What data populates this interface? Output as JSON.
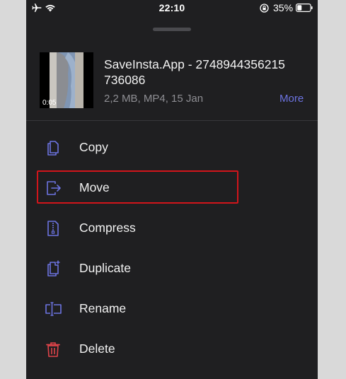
{
  "status_bar": {
    "time": "22:10",
    "battery_percent": "35%",
    "battery_level": 0.35
  },
  "file": {
    "name": "SaveInsta.App - 2748944356215736086",
    "meta": "2,2 MB, MP4, 15 Jan",
    "duration": "0:05",
    "more_label": "More"
  },
  "menu": {
    "items": [
      {
        "label": "Copy",
        "icon": "copy-icon"
      },
      {
        "label": "Move",
        "icon": "move-icon"
      },
      {
        "label": "Compress",
        "icon": "compress-icon"
      },
      {
        "label": "Duplicate",
        "icon": "duplicate-icon"
      },
      {
        "label": "Rename",
        "icon": "rename-icon"
      },
      {
        "label": "Delete",
        "icon": "trash-icon"
      }
    ],
    "highlighted_item": "Move"
  },
  "colors": {
    "background": "#1f1f21",
    "accent": "#6c73e0",
    "delete": "#e0444a",
    "highlight_border": "#d2151b"
  }
}
